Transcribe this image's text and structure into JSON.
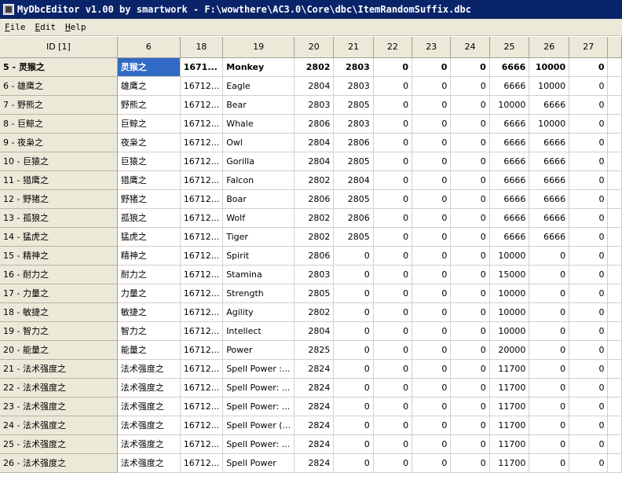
{
  "window": {
    "title": "MyDbcEditor v1.00 by smartwork - F:\\wowthere\\AC3.0\\Core\\dbc\\ItemRandomSuffix.dbc"
  },
  "menu": [
    {
      "key": "F",
      "rest": "ile"
    },
    {
      "key": "E",
      "rest": "dit"
    },
    {
      "key": "H",
      "rest": "elp"
    }
  ],
  "columns": [
    "ID [1]",
    "6",
    "18",
    "19",
    "20",
    "21",
    "22",
    "23",
    "24",
    "25",
    "26",
    "27"
  ],
  "rows": [
    [
      "5 - 灵猴之",
      "灵猴之",
      "1671...",
      "Monkey",
      "2802",
      "2803",
      "0",
      "0",
      "0",
      "6666",
      "10000",
      "0"
    ],
    [
      "6 - 雄鹰之",
      "雄鹰之",
      "16712...",
      "Eagle",
      "2804",
      "2803",
      "0",
      "0",
      "0",
      "6666",
      "10000",
      "0"
    ],
    [
      "7 - 野熊之",
      "野熊之",
      "16712...",
      "Bear",
      "2803",
      "2805",
      "0",
      "0",
      "0",
      "10000",
      "6666",
      "0"
    ],
    [
      "8 - 巨鲸之",
      "巨鲸之",
      "16712...",
      "Whale",
      "2806",
      "2803",
      "0",
      "0",
      "0",
      "6666",
      "10000",
      "0"
    ],
    [
      "9 - 夜枭之",
      "夜枭之",
      "16712...",
      "Owl",
      "2804",
      "2806",
      "0",
      "0",
      "0",
      "6666",
      "6666",
      "0"
    ],
    [
      "10 - 巨猿之",
      "巨猿之",
      "16712...",
      "Gorilla",
      "2804",
      "2805",
      "0",
      "0",
      "0",
      "6666",
      "6666",
      "0"
    ],
    [
      "11 - 猎鹰之",
      "猎鹰之",
      "16712...",
      "Falcon",
      "2802",
      "2804",
      "0",
      "0",
      "0",
      "6666",
      "6666",
      "0"
    ],
    [
      "12 - 野猪之",
      "野猪之",
      "16712...",
      "Boar",
      "2806",
      "2805",
      "0",
      "0",
      "0",
      "6666",
      "6666",
      "0"
    ],
    [
      "13 - 孤狼之",
      "孤狼之",
      "16712...",
      "Wolf",
      "2802",
      "2806",
      "0",
      "0",
      "0",
      "6666",
      "6666",
      "0"
    ],
    [
      "14 - 猛虎之",
      "猛虎之",
      "16712...",
      "Tiger",
      "2802",
      "2805",
      "0",
      "0",
      "0",
      "6666",
      "6666",
      "0"
    ],
    [
      "15 - 精神之",
      "精神之",
      "16712...",
      "Spirit",
      "2806",
      "0",
      "0",
      "0",
      "0",
      "10000",
      "0",
      "0"
    ],
    [
      "16 - 耐力之",
      "耐力之",
      "16712...",
      "Stamina",
      "2803",
      "0",
      "0",
      "0",
      "0",
      "15000",
      "0",
      "0"
    ],
    [
      "17 - 力量之",
      "力量之",
      "16712...",
      "Strength",
      "2805",
      "0",
      "0",
      "0",
      "0",
      "10000",
      "0",
      "0"
    ],
    [
      "18 - 敏捷之",
      "敏捷之",
      "16712...",
      "Agility",
      "2802",
      "0",
      "0",
      "0",
      "0",
      "10000",
      "0",
      "0"
    ],
    [
      "19 - 智力之",
      "智力之",
      "16712...",
      "Intellect",
      "2804",
      "0",
      "0",
      "0",
      "0",
      "10000",
      "0",
      "0"
    ],
    [
      "20 - 能量之",
      "能量之",
      "16712...",
      "Power",
      "2825",
      "0",
      "0",
      "0",
      "0",
      "20000",
      "0",
      "0"
    ],
    [
      "21 - 法术强度之",
      "法术强度之",
      "16712...",
      "Spell Power :...",
      "2824",
      "0",
      "0",
      "0",
      "0",
      "11700",
      "0",
      "0"
    ],
    [
      "22 - 法术强度之",
      "法术强度之",
      "16712...",
      "Spell Power: ...",
      "2824",
      "0",
      "0",
      "0",
      "0",
      "11700",
      "0",
      "0"
    ],
    [
      "23 - 法术强度之",
      "法术强度之",
      "16712...",
      "Spell Power: ...",
      "2824",
      "0",
      "0",
      "0",
      "0",
      "11700",
      "0",
      "0"
    ],
    [
      "24 - 法术强度之",
      "法术强度之",
      "16712...",
      "Spell Power (...",
      "2824",
      "0",
      "0",
      "0",
      "0",
      "11700",
      "0",
      "0"
    ],
    [
      "25 - 法术强度之",
      "法术强度之",
      "16712...",
      "Spell Power: ...",
      "2824",
      "0",
      "0",
      "0",
      "0",
      "11700",
      "0",
      "0"
    ],
    [
      "26 - 法术强度之",
      "法术强度之",
      "16712...",
      "Spell Power",
      "2824",
      "0",
      "0",
      "0",
      "0",
      "11700",
      "0",
      "0"
    ]
  ],
  "selected_row": 0,
  "colors": {
    "titlebar": "#0a246a",
    "header_bg": "#ece9d8",
    "selection": "#316ac5"
  }
}
